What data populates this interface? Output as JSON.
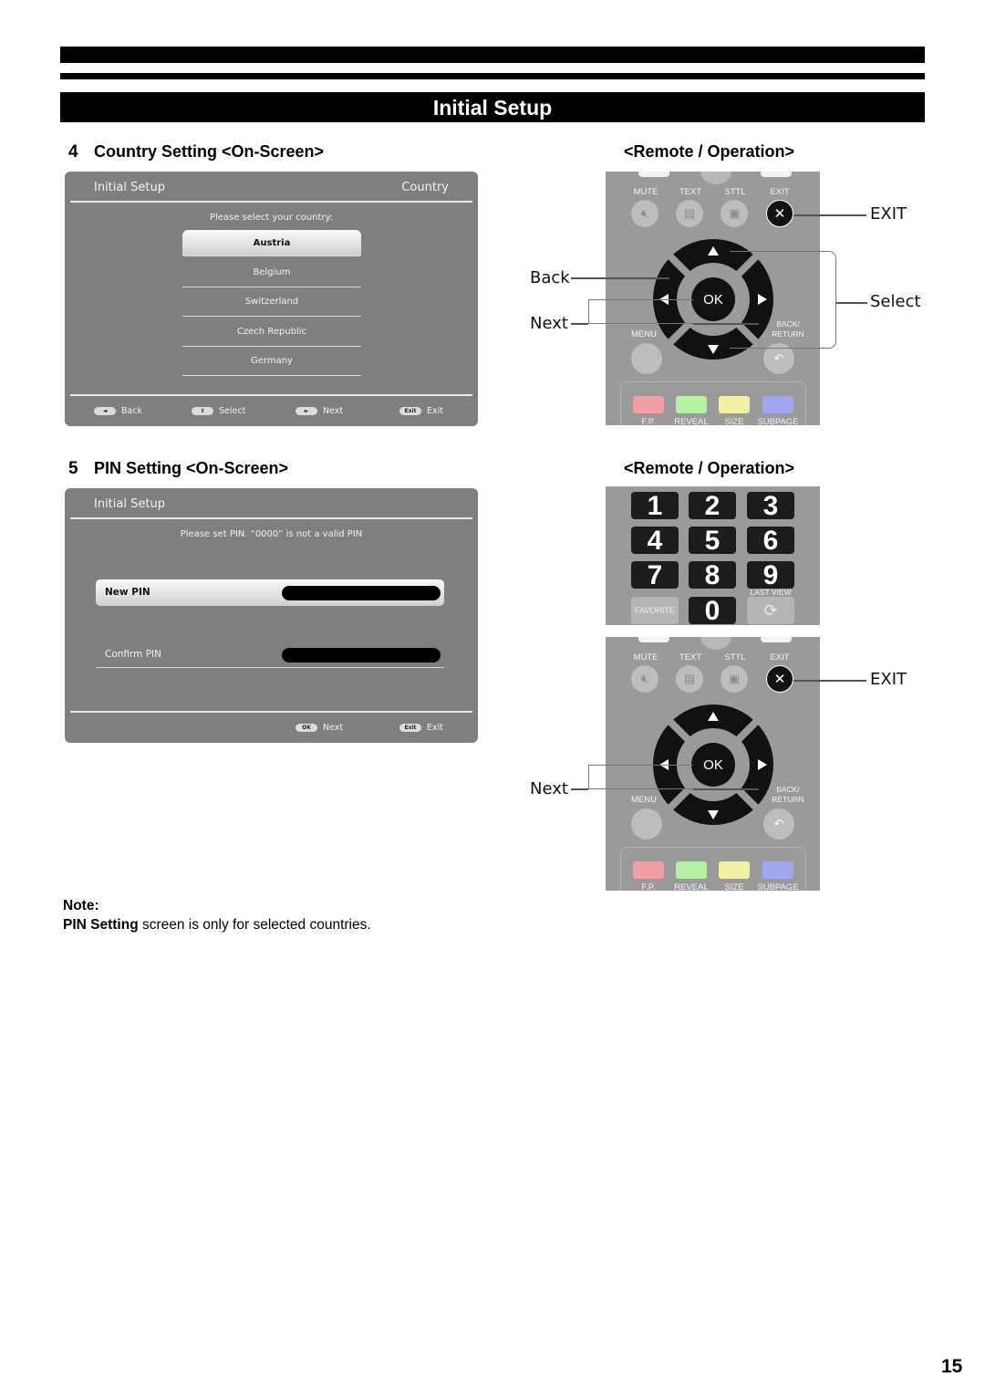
{
  "page": {
    "section_title": "Initial Setup",
    "page_number": "15"
  },
  "step4": {
    "number": "4",
    "title": "Country Setting <On-Screen>",
    "remote_heading": "<Remote / Operation>",
    "screen": {
      "title": "Initial Setup",
      "right_title": "Country",
      "prompt": "Please select your country:",
      "countries": [
        "Austria",
        "Belgium",
        "Switzerland",
        "Czech Republic",
        "Germany"
      ],
      "selected": "Austria",
      "footer": [
        {
          "key": "◄",
          "label": "Back"
        },
        {
          "key": "⇕",
          "label": "Select"
        },
        {
          "key": "►",
          "label": "Next"
        },
        {
          "key": "Exit",
          "label": "Exit"
        }
      ]
    },
    "callouts": {
      "back": "Back",
      "next": "Next",
      "select": "Select",
      "exit": "EXIT"
    }
  },
  "step5": {
    "number": "5",
    "title": "PIN Setting <On-Screen>",
    "remote_heading": "<Remote / Operation>",
    "screen": {
      "title": "Initial Setup",
      "prompt": "Please set PIN. “0000” is not a valid PIN",
      "new_pin_label": "New PIN",
      "confirm_pin_label": "Confirm PIN",
      "footer": [
        {
          "key": "OK",
          "label": "Next"
        },
        {
          "key": "Exit",
          "label": "Exit"
        }
      ]
    },
    "callouts": {
      "next": "Next",
      "exit": "EXIT"
    }
  },
  "remote": {
    "top_labels": [
      "MUTE",
      "TEXT",
      "STTL",
      "EXIT"
    ],
    "ok": "OK",
    "menu": "MENU",
    "back_return": "BACK/\nRETURN",
    "color_labels": [
      "F.P.",
      "REVEAL",
      "SIZE",
      "SUBPAGE"
    ],
    "color_keys": [
      "#f29ea5",
      "#b5f2a2",
      "#f2f0a2",
      "#a2a5f2"
    ],
    "numbers": [
      "1",
      "2",
      "3",
      "4",
      "5",
      "6",
      "7",
      "8",
      "9",
      "0"
    ],
    "favorite": "FAVORITE",
    "last_view": "LAST VIEW"
  },
  "note": {
    "heading": "Note:",
    "bold": "PIN Setting",
    "text": " screen is only for selected countries."
  }
}
